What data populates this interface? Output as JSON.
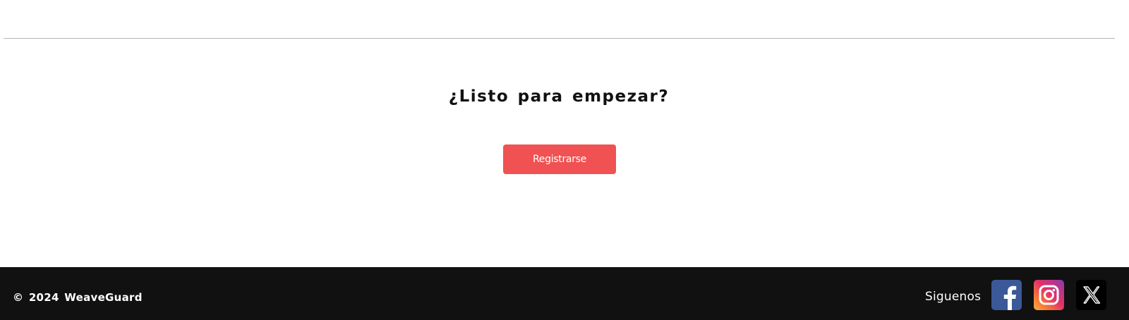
{
  "cta": {
    "title": "¿Listo para empezar?",
    "button_label": "Registrarse",
    "button_color": "#f05152"
  },
  "footer": {
    "copyright": "© 2024 WeaveGuard",
    "follow_label": "Siguenos",
    "background": "#111111",
    "social": [
      {
        "name": "facebook-icon",
        "color": "#3b5998"
      },
      {
        "name": "instagram-icon",
        "color": "#e1306c"
      },
      {
        "name": "x-icon",
        "color": "#000000"
      }
    ]
  }
}
